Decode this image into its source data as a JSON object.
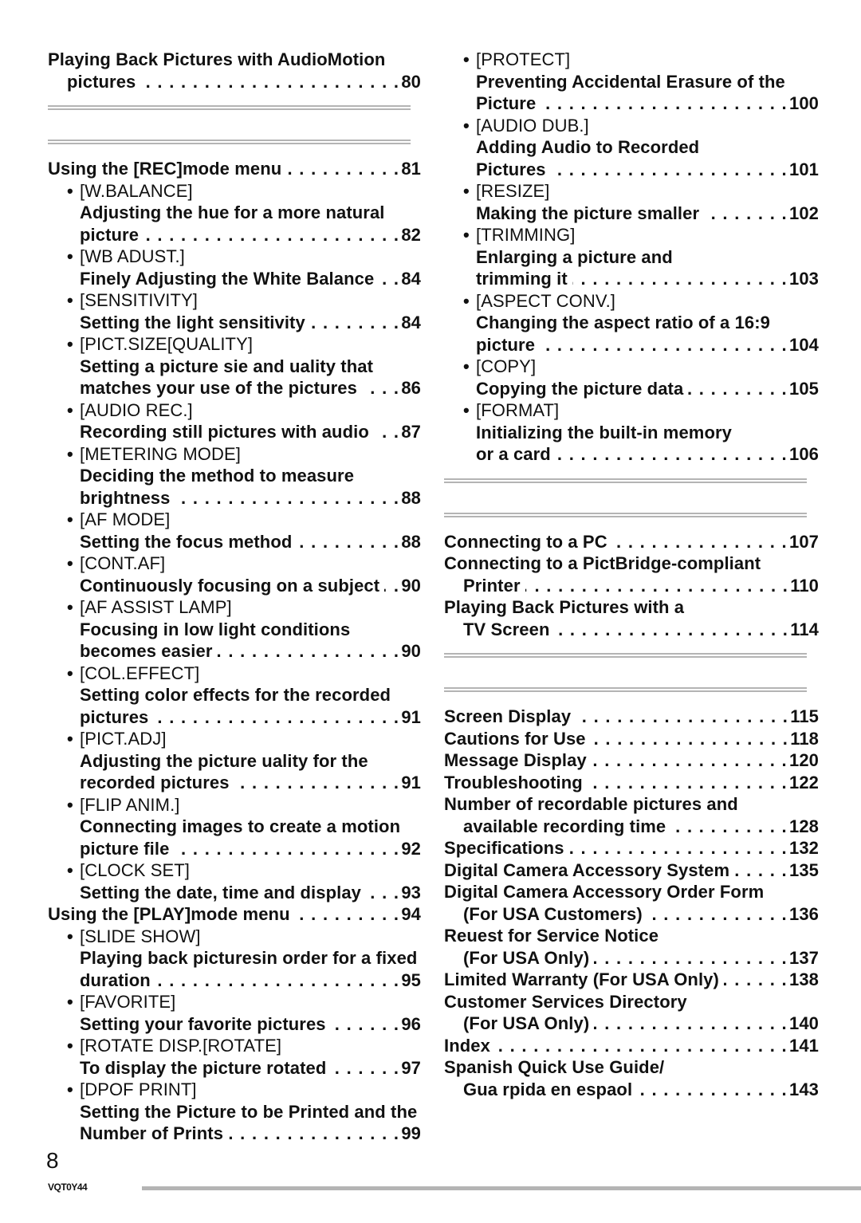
{
  "left_column": [
    {
      "type": "plain",
      "text": "Playing Back Pictures with AudioMotion"
    },
    {
      "type": "lead",
      "indent": 1,
      "text": "pictures",
      "page": "80"
    },
    {
      "type": "rule"
    },
    {
      "type": "lead",
      "indent": 0,
      "text": "Using the [REC]mode menu",
      "page": "81"
    },
    {
      "type": "bullet",
      "text": "[W.BALANCE]"
    },
    {
      "type": "plain",
      "indent": 2,
      "text": "Adjusting the hue for a more natural"
    },
    {
      "type": "lead",
      "indent": 2,
      "text": "picture",
      "page": "82"
    },
    {
      "type": "bullet",
      "text": "[WB ADUST.]"
    },
    {
      "type": "lead",
      "indent": 2,
      "text": "Finely Adjusting the White Balance",
      "page": "84"
    },
    {
      "type": "bullet",
      "text": "[SENSITIVITY]"
    },
    {
      "type": "lead",
      "indent": 2,
      "text": "Setting the light sensitivity",
      "page": "84"
    },
    {
      "type": "bullet",
      "text": "[PICT.SIZE[QUALITY]"
    },
    {
      "type": "plain",
      "indent": 2,
      "text": "Setting a picture sie and uality that"
    },
    {
      "type": "lead",
      "indent": 2,
      "text": "matches your use of the pictures",
      "page": "86"
    },
    {
      "type": "bullet",
      "text": "[AUDIO REC.]"
    },
    {
      "type": "lead",
      "indent": 2,
      "text": "Recording still pictures with audio",
      "page": "87"
    },
    {
      "type": "bullet",
      "text": "[METERING MODE]"
    },
    {
      "type": "plain",
      "indent": 2,
      "text": "Deciding the method to measure"
    },
    {
      "type": "lead",
      "indent": 2,
      "text": "brightness",
      "page": "88"
    },
    {
      "type": "bullet",
      "text": "[AF MODE]"
    },
    {
      "type": "lead",
      "indent": 2,
      "text": "Setting the focus method",
      "page": "88"
    },
    {
      "type": "bullet",
      "text": "[CONT.AF]"
    },
    {
      "type": "lead",
      "indent": 2,
      "text": "Continuously focusing on a subject",
      "page": "90"
    },
    {
      "type": "bullet",
      "text": "[AF ASSIST LAMP]"
    },
    {
      "type": "plain",
      "indent": 2,
      "text": "Focusing in low light conditions"
    },
    {
      "type": "lead",
      "indent": 2,
      "text": "becomes easier",
      "page": "90"
    },
    {
      "type": "bullet",
      "text": "[COL.EFFECT]"
    },
    {
      "type": "plain",
      "indent": 2,
      "text": "Setting color effects for the recorded"
    },
    {
      "type": "lead",
      "indent": 2,
      "text": "pictures",
      "page": "91"
    },
    {
      "type": "bullet",
      "text": "[PICT.ADJ]"
    },
    {
      "type": "plain",
      "indent": 2,
      "text": "Adjusting the picture uality for the"
    },
    {
      "type": "lead",
      "indent": 2,
      "text": "recorded pictures",
      "page": "91"
    },
    {
      "type": "bullet",
      "text": "[FLIP ANIM.]"
    },
    {
      "type": "plain",
      "indent": 2,
      "text": "Connecting images to create a motion"
    },
    {
      "type": "lead",
      "indent": 2,
      "text": "picture file",
      "page": "92"
    },
    {
      "type": "bullet",
      "text": "[CLOCK SET]"
    },
    {
      "type": "lead",
      "indent": 2,
      "text": "Setting the date, time and display",
      "page": "93"
    },
    {
      "type": "lead",
      "indent": 0,
      "text": "Using the [PLAY]mode menu",
      "page": "94"
    },
    {
      "type": "bullet",
      "text": "[SLIDE SHOW]"
    },
    {
      "type": "plain",
      "indent": 2,
      "text": "Playing back picturesin order for a fixed"
    },
    {
      "type": "lead",
      "indent": 2,
      "text": "duration",
      "page": "95"
    },
    {
      "type": "bullet",
      "text": "[FAVORITE]"
    },
    {
      "type": "lead",
      "indent": 2,
      "text": "Setting your favorite pictures",
      "page": "96"
    },
    {
      "type": "bullet",
      "text": "[ROTATE DISP.[ROTATE]"
    },
    {
      "type": "lead",
      "indent": 2,
      "text": "To display the picture rotated",
      "page": "97"
    },
    {
      "type": "bullet",
      "text": "[DPOF PRINT]"
    },
    {
      "type": "plain",
      "indent": 2,
      "text": "Setting the Picture to be Printed and the"
    },
    {
      "type": "lead",
      "indent": 2,
      "text": "Number of Prints",
      "page": "99"
    }
  ],
  "right_column": [
    {
      "type": "bullet",
      "text": "[PROTECT]"
    },
    {
      "type": "plain",
      "indent": 2,
      "text": "Preventing Accidental Erasure of the"
    },
    {
      "type": "lead",
      "indent": 2,
      "text": "Picture",
      "page": "100"
    },
    {
      "type": "bullet",
      "text": "[AUDIO DUB.]"
    },
    {
      "type": "plain",
      "indent": 2,
      "text": "Adding Audio to Recorded"
    },
    {
      "type": "lead",
      "indent": 2,
      "text": "Pictures",
      "page": "101"
    },
    {
      "type": "bullet",
      "text": "[RESIZE]"
    },
    {
      "type": "lead",
      "indent": 2,
      "text": "Making the picture smaller",
      "page": "102"
    },
    {
      "type": "bullet",
      "text": "[TRIMMING]"
    },
    {
      "type": "plain",
      "indent": 2,
      "text": "Enlarging a picture and"
    },
    {
      "type": "lead",
      "indent": 2,
      "text": "trimming it",
      "page": "103"
    },
    {
      "type": "bullet",
      "text": "[ASPECT CONV.]"
    },
    {
      "type": "plain",
      "indent": 2,
      "text": "Changing the aspect ratio of a 16:9"
    },
    {
      "type": "lead",
      "indent": 2,
      "text": "picture",
      "page": "104"
    },
    {
      "type": "bullet",
      "text": "[COPY]"
    },
    {
      "type": "lead",
      "indent": 2,
      "text": "Copying the picture data",
      "page": "105"
    },
    {
      "type": "bullet",
      "text": "[FORMAT]"
    },
    {
      "type": "plain",
      "indent": 2,
      "text": "Initializing the built-in memory"
    },
    {
      "type": "lead",
      "indent": 2,
      "text": "or a card",
      "page": "106"
    },
    {
      "type": "rule"
    },
    {
      "type": "lead",
      "indent": 0,
      "text": "Connecting to a PC",
      "page": "107"
    },
    {
      "type": "plain",
      "indent": 0,
      "text": "Connecting to a PictBridge-compliant"
    },
    {
      "type": "lead",
      "indent": 1,
      "text": "Printer",
      "page": "110"
    },
    {
      "type": "plain",
      "indent": 0,
      "text": "Playing Back Pictures with a"
    },
    {
      "type": "lead",
      "indent": 1,
      "text": "TV Screen",
      "page": "114"
    },
    {
      "type": "rule"
    },
    {
      "type": "lead",
      "indent": 0,
      "text": "Screen Display",
      "page": "115"
    },
    {
      "type": "lead",
      "indent": 0,
      "text": "Cautions for Use",
      "page": "118"
    },
    {
      "type": "lead",
      "indent": 0,
      "text": "Message Display",
      "page": "120"
    },
    {
      "type": "lead",
      "indent": 0,
      "text": "Troubleshooting",
      "page": "122"
    },
    {
      "type": "plain",
      "indent": 0,
      "text": "Number of recordable pictures and"
    },
    {
      "type": "lead",
      "indent": 1,
      "text": "available recording time",
      "page": "128"
    },
    {
      "type": "lead",
      "indent": 0,
      "text": "Specifications",
      "page": "132"
    },
    {
      "type": "lead",
      "indent": 0,
      "text": "Digital Camera Accessory System",
      "page": "135"
    },
    {
      "type": "plain",
      "indent": 0,
      "text": "Digital Camera Accessory Order Form"
    },
    {
      "type": "lead",
      "indent": 1,
      "text": "(For USA Customers)",
      "page": "136"
    },
    {
      "type": "plain",
      "indent": 0,
      "text": "Reuest for Service Notice"
    },
    {
      "type": "lead",
      "indent": 1,
      "text": "(For USA Only)",
      "page": "137"
    },
    {
      "type": "lead",
      "indent": 0,
      "text": "Limited Warranty (For USA Only)",
      "page": "138"
    },
    {
      "type": "plain",
      "indent": 0,
      "text": "Customer Services Directory"
    },
    {
      "type": "lead",
      "indent": 1,
      "text": "(For USA Only)",
      "page": "140"
    },
    {
      "type": "lead",
      "indent": 0,
      "text": "Index",
      "page": "141"
    },
    {
      "type": "plain",
      "indent": 0,
      "text": "Spanish Quick Use Guide/"
    },
    {
      "type": "lead",
      "indent": 1,
      "text": "Gua rpida en espaol",
      "page": "143"
    }
  ],
  "footer": {
    "page_number": "8",
    "doc_code": "VQT0Y44"
  },
  "colors": {
    "text": "#111111",
    "rule": "#b4b4b4"
  },
  "bullet_glyph": "•"
}
